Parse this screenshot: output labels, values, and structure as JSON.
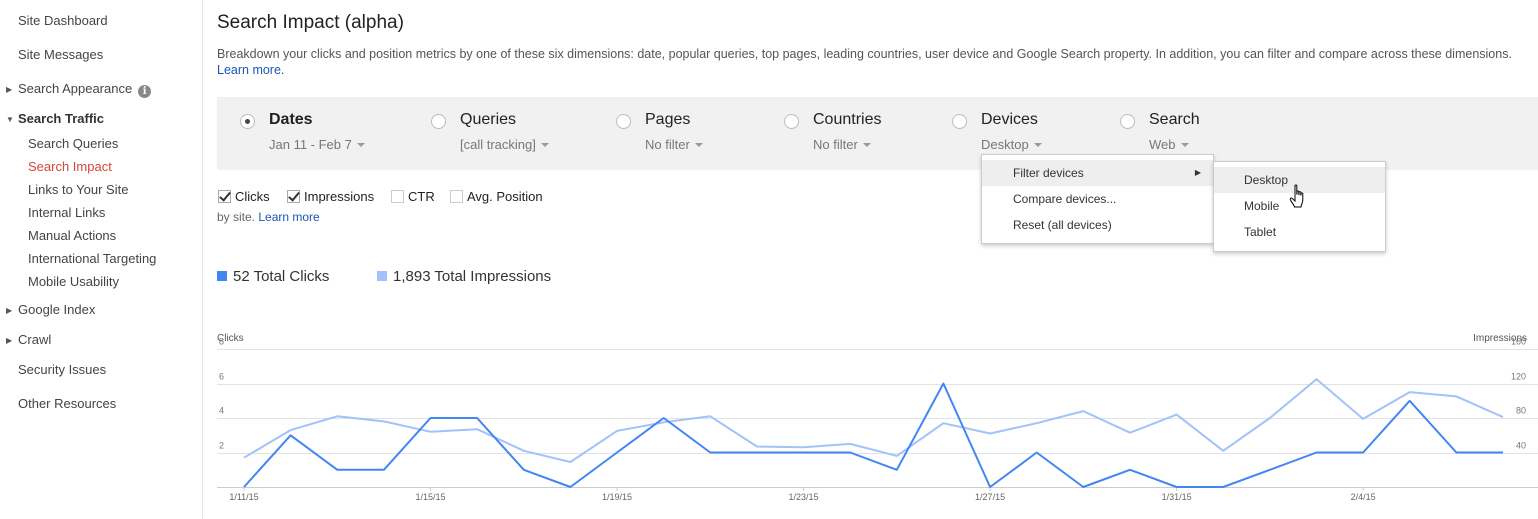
{
  "sidebar": {
    "top_items": [
      {
        "label": "Site Dashboard"
      },
      {
        "label": "Site Messages"
      }
    ],
    "search_appearance": {
      "label": "Search Appearance",
      "info_icon": "info-icon"
    },
    "search_traffic": {
      "label": "Search Traffic",
      "items": [
        {
          "label": "Search Queries"
        },
        {
          "label": "Search Impact",
          "active": true
        },
        {
          "label": "Links to Your Site"
        },
        {
          "label": "Internal Links"
        },
        {
          "label": "Manual Actions"
        },
        {
          "label": "International Targeting"
        },
        {
          "label": "Mobile Usability"
        }
      ]
    },
    "google_index": {
      "label": "Google Index"
    },
    "crawl": {
      "label": "Crawl"
    },
    "bottom_items": [
      {
        "label": "Security Issues"
      },
      {
        "label": "Other Resources"
      }
    ]
  },
  "main": {
    "title": "Search Impact (alpha)",
    "description": "Breakdown your clicks and position metrics by one of these six dimensions: date, popular queries, top pages, leading countries, user device and Google Search property. In addition, you can filter and compare across these dimensions.",
    "learn_more": "Learn more.",
    "dimensions": [
      {
        "label": "Dates",
        "filter": "Jan 11 - Feb 7",
        "selected": true
      },
      {
        "label": "Queries",
        "filter": "[call tracking]"
      },
      {
        "label": "Pages",
        "filter": "No filter"
      },
      {
        "label": "Countries",
        "filter": "No filter"
      },
      {
        "label": "Devices",
        "filter": "Desktop"
      },
      {
        "label": "Search",
        "filter": "Web"
      }
    ],
    "metrics": [
      {
        "label": "Clicks",
        "checked": true
      },
      {
        "label": "Impressions",
        "checked": true
      },
      {
        "label": "CTR",
        "checked": false
      },
      {
        "label": "Avg. Position",
        "checked": false
      }
    ],
    "by_site_text": "by site.",
    "by_site_link": "Learn more",
    "totals": {
      "clicks": "52 Total Clicks",
      "impressions": "1,893 Total Impressions"
    }
  },
  "device_menu": {
    "items": [
      {
        "label": "Filter devices",
        "has_submenu": true,
        "highlighted": true
      },
      {
        "label": "Compare devices..."
      },
      {
        "label": "Reset (all devices)"
      }
    ],
    "submenu_arrow_icon": "submenu-arrow-icon",
    "submenu": [
      {
        "label": "Desktop",
        "highlighted": true
      },
      {
        "label": "Mobile"
      },
      {
        "label": "Tablet"
      }
    ]
  },
  "colors": {
    "clicks": "#4285f4",
    "impressions": "#a1c2fa",
    "active_nav": "#d14836",
    "link": "#1a55b8",
    "filter_bar": "#f1f1f1"
  },
  "chart_data": {
    "type": "line",
    "ylabel_left": "Clicks",
    "ylabel_right": "Impressions",
    "left_ticks": [
      "2",
      "4",
      "6",
      "8"
    ],
    "right_ticks": [
      "40",
      "80",
      "120",
      "160"
    ],
    "ylim_left": [
      0,
      8
    ],
    "ylim_right": [
      0,
      160
    ],
    "x_tick_labels": [
      "1/11/15",
      "1/15/15",
      "1/19/15",
      "1/23/15",
      "1/27/15",
      "1/31/15",
      "2/4/15"
    ],
    "x": [
      "1/11/15",
      "1/12/15",
      "1/13/15",
      "1/14/15",
      "1/15/15",
      "1/16/15",
      "1/17/15",
      "1/18/15",
      "1/19/15",
      "1/20/15",
      "1/21/15",
      "1/22/15",
      "1/23/15",
      "1/24/15",
      "1/25/15",
      "1/26/15",
      "1/27/15",
      "1/28/15",
      "1/29/15",
      "1/30/15",
      "1/31/15",
      "2/1/15",
      "2/2/15",
      "2/3/15",
      "2/4/15",
      "2/5/15",
      "2/6/15",
      "2/7/15"
    ],
    "series": [
      {
        "name": "Clicks",
        "axis": "left",
        "color": "#4285f4",
        "values": [
          0,
          3,
          1,
          1,
          4,
          4,
          1,
          0,
          2,
          4,
          2,
          2,
          2,
          2,
          1,
          6,
          0,
          2,
          0,
          1,
          0,
          0,
          1,
          2,
          2,
          5,
          2,
          2
        ]
      },
      {
        "name": "Impressions",
        "axis": "right",
        "color": "#a1c2fa",
        "values": [
          34,
          66,
          82,
          76,
          64,
          67,
          42,
          29,
          65,
          75,
          82,
          47,
          46,
          50,
          36,
          74,
          62,
          74,
          88,
          63,
          84,
          42,
          80,
          125,
          79,
          110,
          105,
          81
        ]
      }
    ],
    "grid": true
  }
}
